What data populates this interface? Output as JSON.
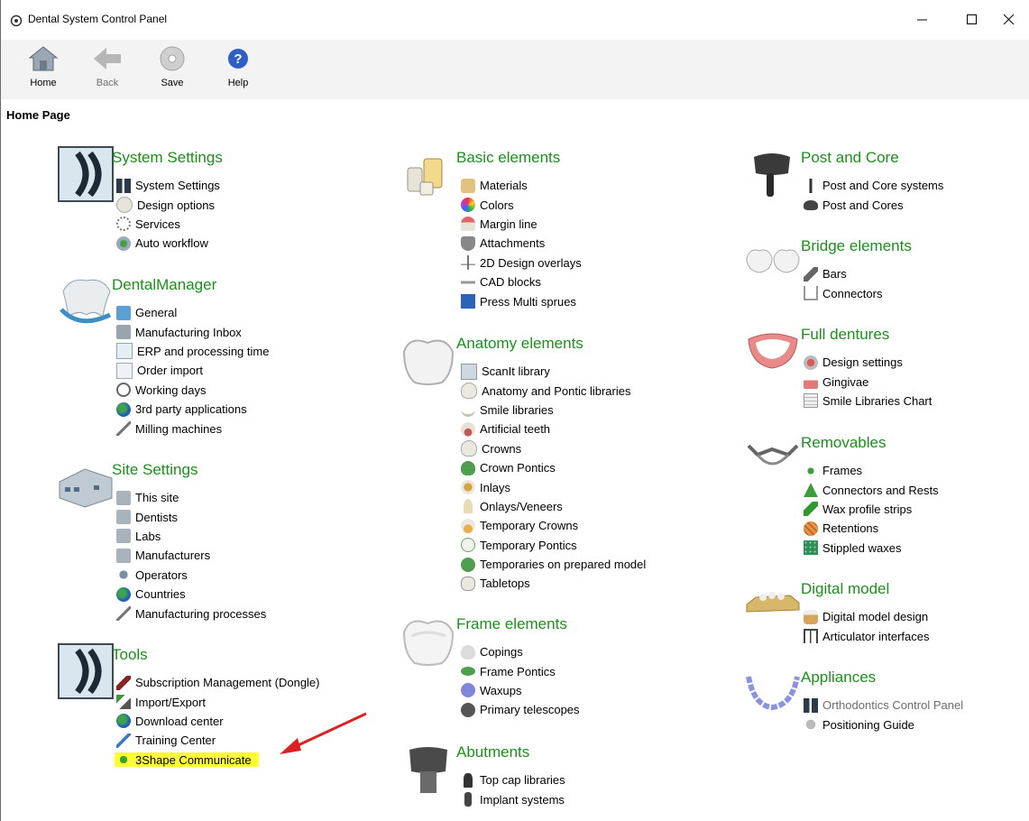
{
  "window": {
    "title": "Dental System Control Panel"
  },
  "toolbar": {
    "home": "Home",
    "back": "Back",
    "save": "Save",
    "help": "Help"
  },
  "page": {
    "title": "Home Page"
  },
  "col1": [
    {
      "title": "System Settings",
      "icon": "chevron-panel-icon",
      "items": [
        "System Settings",
        "Design options",
        "Services",
        "Auto workflow"
      ]
    },
    {
      "title": "DentalManager",
      "icon": "dental-manager-icon",
      "items": [
        "General",
        "Manufacturing Inbox",
        "ERP and processing time",
        "Order import",
        "Working days",
        "3rd party applications",
        "Milling machines"
      ]
    },
    {
      "title": "Site Settings",
      "icon": "building-icon",
      "items": [
        "This site",
        "Dentists",
        "Labs",
        "Manufacturers",
        "Operators",
        "Countries",
        "Manufacturing processes"
      ]
    },
    {
      "title": "Tools",
      "icon": "chevron-panel-icon",
      "items": [
        "Subscription Management (Dongle)",
        "Import/Export",
        "Download center",
        "Training Center",
        "3Shape Communicate"
      ]
    }
  ],
  "col2": [
    {
      "title": "Basic elements",
      "icon": "bottles-icon",
      "items": [
        "Materials",
        "Colors",
        "Margin line",
        "Attachments",
        "2D Design overlays",
        "CAD blocks",
        "Press Multi sprues"
      ]
    },
    {
      "title": "Anatomy elements",
      "icon": "tooth-icon",
      "items": [
        "ScanIt library",
        "Anatomy and Pontic libraries",
        "Smile libraries",
        "Artificial teeth",
        "Crowns",
        "Crown Pontics",
        "Inlays",
        "Onlays/Veneers",
        "Temporary Crowns",
        "Temporary Pontics",
        "Temporaries on prepared model",
        "Tabletops"
      ]
    },
    {
      "title": "Frame elements",
      "icon": "frame-tooth-icon",
      "items": [
        "Copings",
        "Frame Pontics",
        "Waxups",
        "Primary telescopes"
      ]
    },
    {
      "title": "Abutments",
      "icon": "abutment-icon",
      "items": [
        "Top cap libraries",
        "Implant systems"
      ]
    }
  ],
  "col3": [
    {
      "title": "Post and Core",
      "icon": "post-core-icon",
      "items": [
        "Post and Core systems",
        "Post and Cores"
      ]
    },
    {
      "title": "Bridge elements",
      "icon": "bridge-icon",
      "items": [
        "Bars",
        "Connectors"
      ]
    },
    {
      "title": "Full dentures",
      "icon": "dentures-icon",
      "items": [
        "Design settings",
        "Gingivae",
        "Smile Libraries Chart"
      ]
    },
    {
      "title": "Removables",
      "icon": "removable-frame-icon",
      "items": [
        "Frames",
        "Connectors and Rests",
        "Wax profile strips",
        "Retentions",
        "Stippled waxes"
      ]
    },
    {
      "title": "Digital model",
      "icon": "digital-model-icon",
      "items": [
        "Digital model design",
        "Articulator interfaces"
      ]
    },
    {
      "title": "Appliances",
      "icon": "appliance-icon",
      "items": [
        "Orthodontics Control Panel",
        "Positioning Guide"
      ]
    }
  ],
  "colors": {
    "section_title": "#1d8f1d",
    "highlight": "#ffff33",
    "annotation_arrow": "#e02020",
    "disabled_text": "#6d6d6d"
  }
}
